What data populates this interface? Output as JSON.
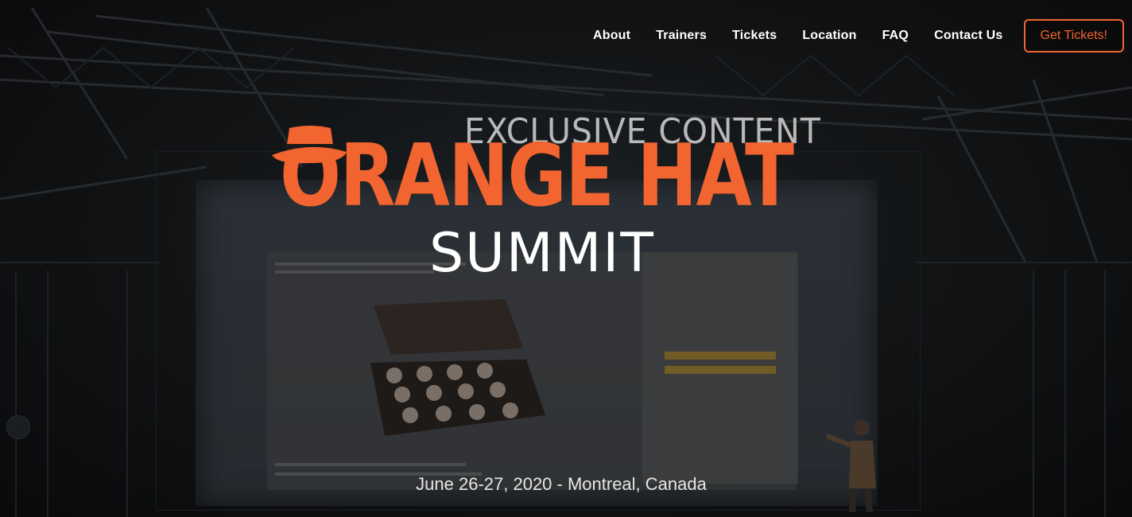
{
  "nav": {
    "items": [
      {
        "label": "About"
      },
      {
        "label": "Trainers"
      },
      {
        "label": "Tickets"
      },
      {
        "label": "Location"
      },
      {
        "label": "FAQ"
      },
      {
        "label": "Contact Us"
      }
    ],
    "cta_label": "Get Tickets!"
  },
  "hero": {
    "eyebrow": "EXCLUSIVE CONTENT",
    "brand": "ORANGE HAT",
    "subtitle": "SUMMIT",
    "date_location": "June 26-27, 2020 - Montreal, Canada"
  },
  "colors": {
    "accent": "#f26430",
    "background": "#0b0b0c",
    "text": "#ffffff"
  },
  "icons": {
    "logo": "orange-hat-icon",
    "chat": "chat-bubble-icon"
  }
}
